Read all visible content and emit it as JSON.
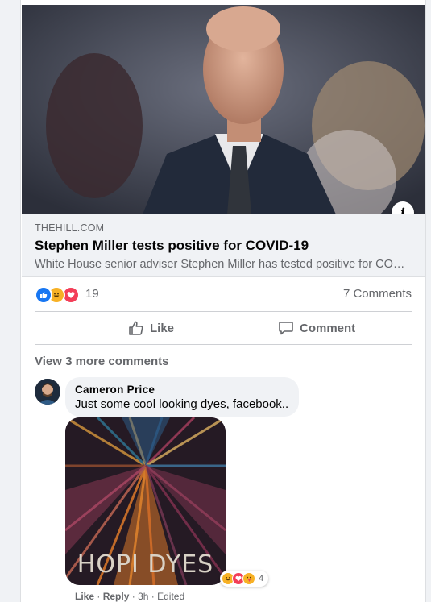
{
  "link_preview": {
    "domain": "THEHILL.COM",
    "headline": "Stephen Miller tests positive for COVID-19",
    "description": "White House senior adviser Stephen Miller has tested positive for COVID-19",
    "info_icon": "info-icon"
  },
  "post_stats": {
    "reaction_icons": [
      "like-reaction-icon",
      "haha-reaction-icon",
      "love-reaction-icon"
    ],
    "reaction_count": "19",
    "comments_count": "7 Comments"
  },
  "actions": {
    "like_label": "Like",
    "comment_label": "Comment"
  },
  "comments": {
    "view_more": "View 3 more comments",
    "items": [
      {
        "author": "Cameron Price",
        "text": "Just some cool looking dyes, facebook..",
        "image_caption": "HOPI DYES",
        "reaction_count": "4",
        "like_label": "Like",
        "reply_label": "Reply",
        "time": "3h",
        "edited": "Edited"
      }
    ]
  },
  "colors": {
    "accent_blue": "#1877f2",
    "love_red": "#f33e58",
    "haha_yellow": "#f7b125",
    "secondary_text": "#65676b"
  }
}
